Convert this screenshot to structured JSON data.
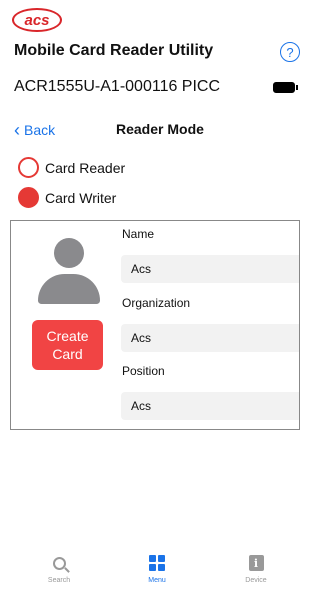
{
  "header": {
    "logo_text": "acs",
    "app_title": "Mobile Card Reader Utility",
    "help_glyph": "?",
    "device_name": "ACR1555U-A1-000116 PICC"
  },
  "nav": {
    "back_label": "Back",
    "back_glyph": "‹",
    "title": "Reader Mode"
  },
  "mode_options": [
    {
      "label": "Card Reader",
      "selected": false
    },
    {
      "label": "Card Writer",
      "selected": true
    }
  ],
  "card_form": {
    "create_button_label": "Create Card",
    "fields": [
      {
        "label": "Name",
        "value": "Acs"
      },
      {
        "label": "Organization",
        "value": "Acs"
      },
      {
        "label": "Position",
        "value": "Acs"
      }
    ]
  },
  "tab_bar": {
    "tabs": [
      {
        "label": "Search",
        "icon": "search-icon",
        "active": false
      },
      {
        "label": "Menu",
        "icon": "grid-icon",
        "active": true
      },
      {
        "label": "Device",
        "icon": "info-icon",
        "active": false
      }
    ]
  },
  "colors": {
    "accent_blue": "#1a73e8",
    "accent_red": "#e53935",
    "button_red": "#f14444"
  }
}
